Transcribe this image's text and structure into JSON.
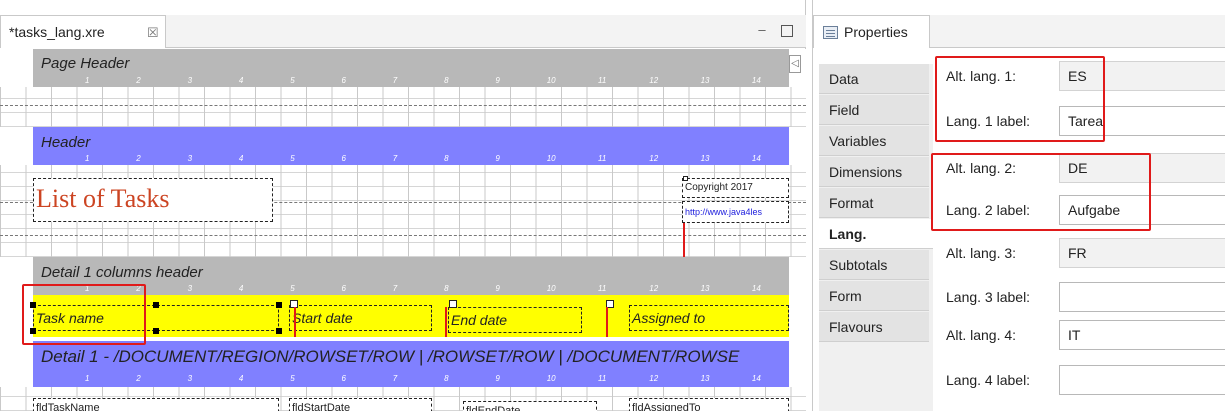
{
  "editor": {
    "tab_title": "*tasks_lang.xre",
    "tab_close": "☒",
    "minimize": "▭",
    "maximize": ""
  },
  "report": {
    "ruler_labels": [
      "1",
      "2",
      "3",
      "4",
      "5",
      "6",
      "7",
      "8",
      "9",
      "10",
      "11",
      "12",
      "13",
      "14"
    ],
    "page_header": "Page Header",
    "header": "Header",
    "detail_columns_header": "Detail 1 columns header",
    "detail_band": "Detail 1 - /DOCUMENT/REGION/ROWSET/ROW | /ROWSET/ROW | /DOCUMENT/ROWSE",
    "title_field": "List of Tasks",
    "copyright_field": "Copyright 2017",
    "url_field": "http://www.java4les",
    "col_task_name": "Task name",
    "col_start_date": "Start date",
    "col_end_date": "End date",
    "col_assigned_to": "Assigned to",
    "fld_task_name": "fldTaskName",
    "fld_start_date": "fldStartDate",
    "fld_end_date": "fldEndDate",
    "fld_assigned_to": "fldAssignedTo"
  },
  "properties": {
    "tab_title": "Properties",
    "categories": [
      "Data",
      "Field",
      "Variables",
      "Dimensions",
      "Format",
      "Lang.",
      "Subtotals",
      "Form",
      "Flavours"
    ],
    "selected_category": "Lang.",
    "fields": [
      {
        "label": "Alt. lang. 1:",
        "value": "ES",
        "readonly": true
      },
      {
        "label": "Lang. 1 label:",
        "value": "Tarea",
        "readonly": false
      },
      {
        "label": "Alt. lang. 2:",
        "value": "DE",
        "readonly": true
      },
      {
        "label": "Lang. 2 label:",
        "value": "Aufgabe",
        "readonly": false
      },
      {
        "label": "Alt. lang. 3:",
        "value": "FR",
        "readonly": true
      },
      {
        "label": "Lang. 3 label:",
        "value": "",
        "readonly": false
      },
      {
        "label": "Alt. lang. 4:",
        "value": "IT",
        "readonly": false
      },
      {
        "label": "Lang. 4 label:",
        "value": "",
        "readonly": false
      }
    ]
  },
  "colors": {
    "gray_band": "#b8b8b8",
    "blue_band": "#8080ff",
    "yellow_band": "#ffff00",
    "title_red": "#cc4422",
    "link_blue": "#2020dd",
    "highlight_red": "#e01a1a"
  }
}
